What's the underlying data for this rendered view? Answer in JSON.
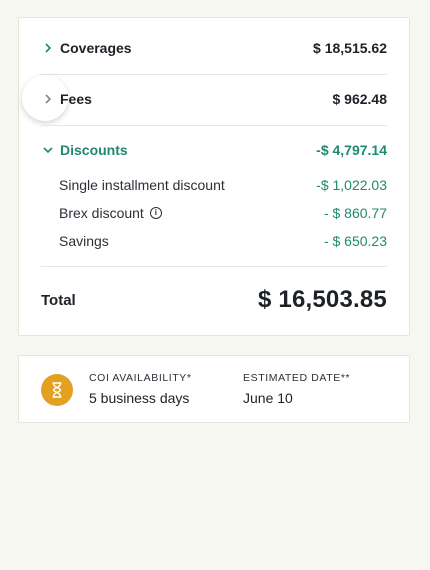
{
  "summary": {
    "coverages": {
      "label": "Coverages",
      "amount": "$ 18,515.62"
    },
    "fees": {
      "label": "Fees",
      "amount": "$ 962.48"
    },
    "discounts": {
      "label": "Discounts",
      "amount": "-$ 4,797.14"
    },
    "discount_items": [
      {
        "label": "Single installment discount",
        "amount": "-$ 1,022.03"
      },
      {
        "label": "Brex discount",
        "amount": "- $ 860.77"
      },
      {
        "label": "Savings",
        "amount": "- $ 650.23"
      }
    ],
    "total": {
      "label": "Total",
      "amount": "$ 16,503.85"
    }
  },
  "icons": {
    "collapsed": "chevron-right-icon",
    "expanded": "chevron-down-icon",
    "info": "info-icon",
    "availability": "hourglass-icon"
  },
  "coi": {
    "availability_label": "COI AVAILABILITY*",
    "availability_value": "5 business days",
    "date_label": "ESTIMATED DATE**",
    "date_value": "June 10"
  },
  "colors": {
    "accent": "#1f8a6e",
    "hourglass": "#e3a021",
    "background": "#f6f7f1"
  }
}
